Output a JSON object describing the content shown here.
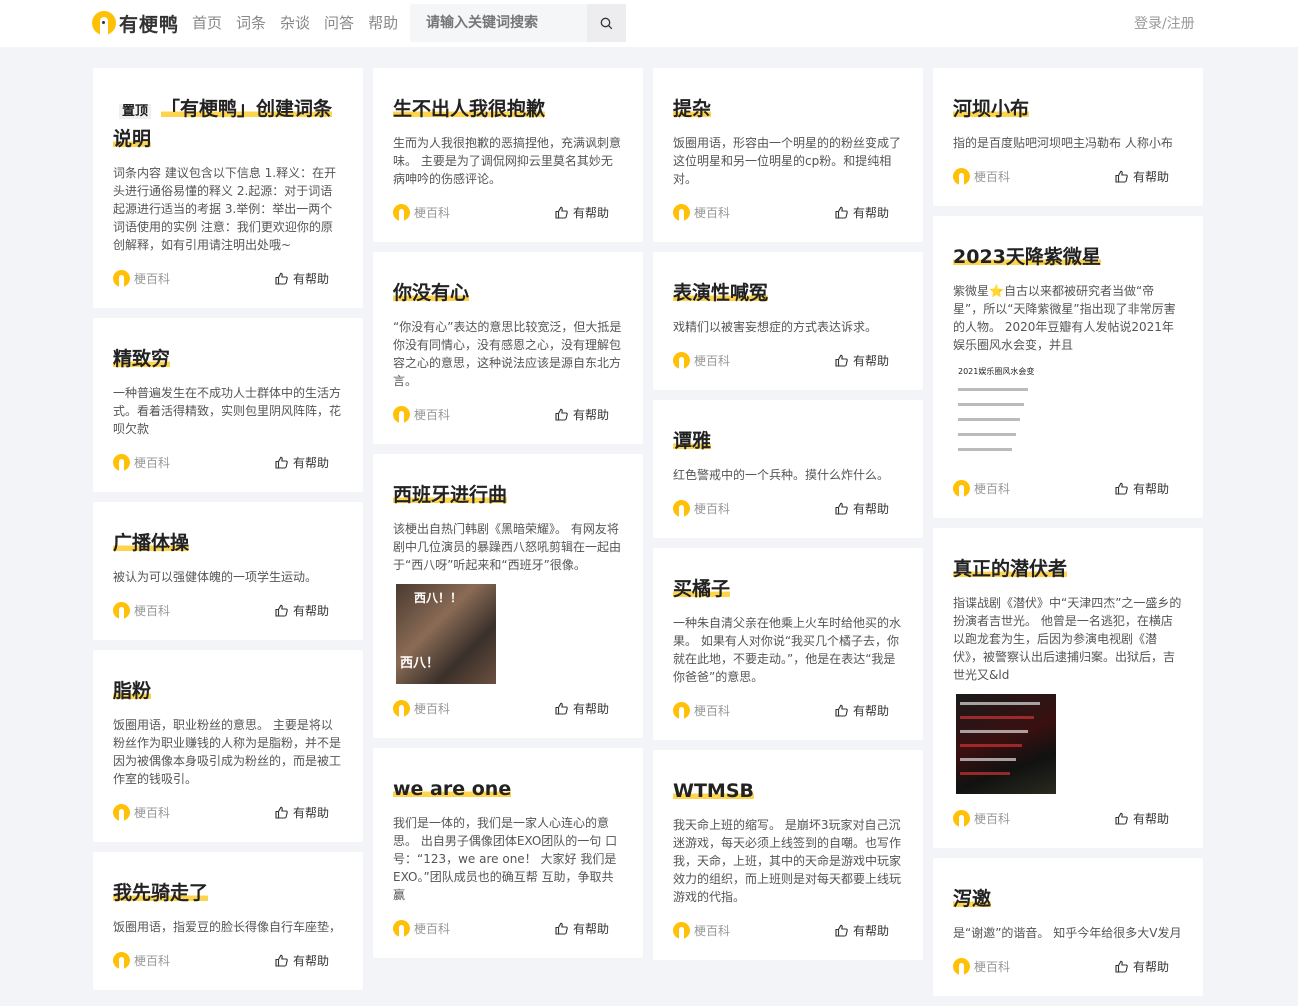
{
  "header": {
    "brand": "有梗鸭",
    "nav": [
      "首页",
      "词条",
      "杂谈",
      "问答",
      "帮助"
    ],
    "search_placeholder": "请输入关键词搜索",
    "login": "登录/注册"
  },
  "common": {
    "author": "梗百科",
    "help": "有帮助",
    "pin": "置顶"
  },
  "columns": [
    [
      {
        "title": "「有梗鸭」创建词条说明",
        "pinned": true,
        "desc": "词条内容 建议包含以下信息 1.释义：在开头进行通俗易懂的释义 2.起源：对于词语起源进行适当的考据 3.举例：举出一两个词语使用的实例 注意：我们更欢迎你的原创解释，如有引用请注明出处哦~"
      },
      {
        "title": "精致穷",
        "desc": "一种普遍发生在不成功人士群体中的生活方式。看着活得精致，实则包里阴风阵阵，花呗欠款"
      },
      {
        "title": "广播体操",
        "desc": "被认为可以强健体魄的一项学生运动。"
      },
      {
        "title": "脂粉",
        "desc": "饭圈用语，职业粉丝的意思。 主要是将以粉丝作为职业赚钱的人称为是脂粉，并不是因为被偶像本身吸引成为粉丝的，而是被工作室的钱吸引。"
      },
      {
        "title": "我先骑走了",
        "desc": "饭圈用语，指爱豆的脸长得像自行车座垫，"
      }
    ],
    [
      {
        "title": "生不出人我很抱歉",
        "desc": "生而为人我很抱歉的恶搞捏他，充满讽刺意味。 主要是为了调侃网抑云里莫名其妙无病呻吟的伤感评论。"
      },
      {
        "title": "你没有心",
        "desc": "“你没有心”表达的意思比较宽泛，但大抵是你没有同情心，没有感恩之心，没有理解包容之心的意思，这种说法应该是源自东北方言。"
      },
      {
        "title": "西班牙进行曲",
        "desc": "该梗出自热门韩剧《黑暗荣耀》。 有网友将剧中几位演员的暴躁西八怒吼剪辑在一起由于“西八呀”听起来和“西班牙”很像。",
        "image": "meme"
      },
      {
        "title": "we are one",
        "desc": "我们是一体的，我们是一家人心连心的意思。 出自男子偶像团体EXO团队的一句 口号：“123，we are one！ 大家好 我们是EXO。”团队成员也的确互帮 互助，争取共赢"
      }
    ],
    [
      {
        "title": "提杂",
        "desc": "饭圈用语，形容由一个明星的的粉丝变成了这位明星和另一位明星的cp粉。和提纯相对。"
      },
      {
        "title": "表演性喊冤",
        "desc": "戏精们以被害妄想症的方式表达诉求。"
      },
      {
        "title": "谭雅",
        "desc": "红色警戒中的一个兵种。摸什么炸什么。"
      },
      {
        "title": "买橘子",
        "desc": "一种朱自清父亲在他乘上火车时给他买的水果。 如果有人对你说“我买几个橘子去，你就在此地，不要走动。”，他是在表达“我是你爸爸”的意思。"
      },
      {
        "title": "WTMSB",
        "desc": "我天命上班的缩写。 是崩坏3玩家对自己沉迷游戏，每天必须上线签到的自嘲。也写作我，天命，上班，其中的天命是游戏中玩家效力的组织，而上班则是对每天都要上线玩游戏的代指。"
      }
    ],
    [
      {
        "title": "河坝小布",
        "desc": "指的是百度贴吧河坝吧主冯勒布 人称小布"
      },
      {
        "title": "2023天降紫微星",
        "desc": "紫微星⭐自古以来都被研究者当做“帝星”，所以“天降紫微星”指出现了非常厉害的人物。 2020年豆瓣有人发帖说2021年娱乐圈风水会变，并且",
        "image": "list"
      },
      {
        "title": "真正的潜伏者",
        "desc": "指谍战剧《潜伏》中“天津四杰”之一盛乡的扮演者吉世光。 他曾是一名逃犯，在横店以跑龙套为生，后因为参演电视剧《潜伏》，被警察认出后逮捕归案。出狱后，吉世光又&ld",
        "image": "dark"
      },
      {
        "title": "泻邀",
        "desc": "是“谢邀”的谐音。 知乎今年给很多大V发月"
      }
    ]
  ],
  "image_text": {
    "meme": [
      "西八！！",
      "西八！"
    ],
    "list_title": "2021娱乐圈风水会变"
  }
}
